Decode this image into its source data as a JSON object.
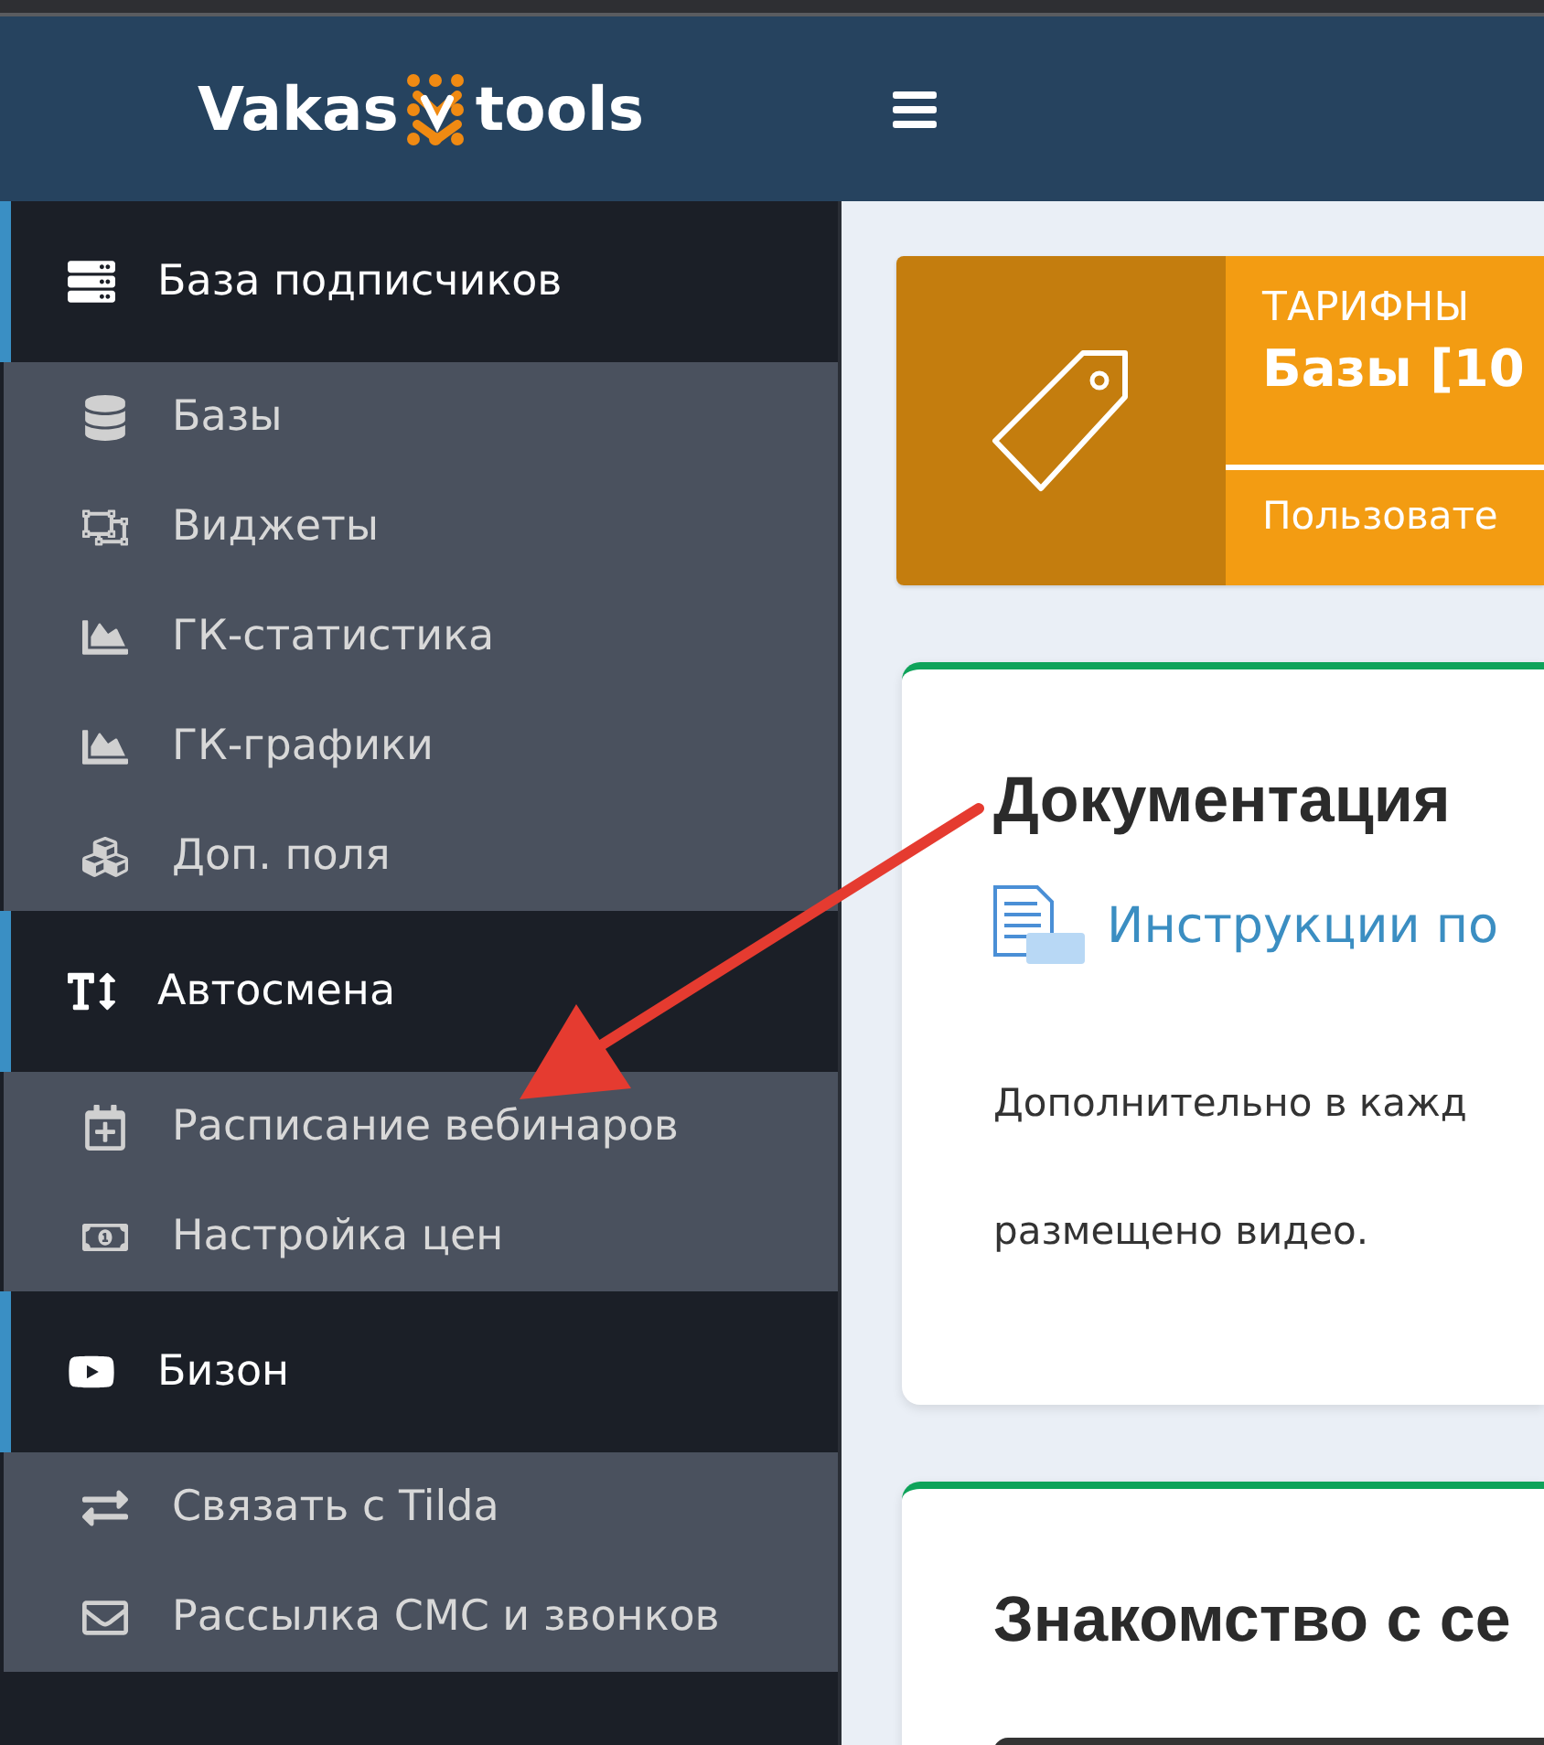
{
  "header": {
    "logo": {
      "left": "Vakas",
      "right": "tools"
    }
  },
  "sidebar": {
    "sections": [
      {
        "label": "База подписчиков",
        "expanded": true,
        "items": [
          {
            "label": "Базы"
          },
          {
            "label": "Виджеты"
          },
          {
            "label": "ГК-статистика"
          },
          {
            "label": "ГК-графики"
          },
          {
            "label": "Доп. поля"
          }
        ]
      },
      {
        "label": "Автосмена",
        "expanded": true,
        "items": [
          {
            "label": "Расписание вебинаров"
          },
          {
            "label": "Настройка цен"
          }
        ]
      },
      {
        "label": "Бизон",
        "expanded": true,
        "items": [
          {
            "label": "Связать с Tilda"
          },
          {
            "label": "Рассылка СМС и звонков"
          }
        ]
      }
    ]
  },
  "plan_card": {
    "caption": "ТАРИФНЫ",
    "value": "Базы [10",
    "footer": "Пользовате"
  },
  "docs_card": {
    "title": "Документация",
    "link": "Инструкции по",
    "lines": [
      "Дополнительно в кажд",
      "размещено видео."
    ]
  },
  "intro_card": {
    "title": "Знакомство с се"
  }
}
